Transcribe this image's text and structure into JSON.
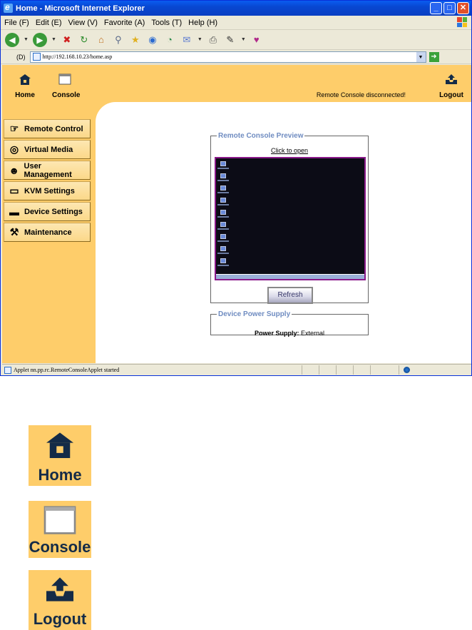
{
  "window": {
    "title": "Home - Microsoft Internet Explorer",
    "minimize": "_",
    "maximize": "□",
    "close": "✕"
  },
  "menu": [
    "File (F)",
    "Edit (E)",
    "View (V)",
    "Favorite (A)",
    "Tools (T)",
    "Help (H)"
  ],
  "address": {
    "label": "(D)",
    "url": "http://192.168.10.23/home.asp"
  },
  "header": {
    "home_label": "Home",
    "console_label": "Console",
    "logout_label": "Logout",
    "status_message": "Remote Console disconnected!"
  },
  "nav": {
    "items": [
      {
        "label": "Remote Control",
        "icon": "remote-control-icon"
      },
      {
        "label": "Virtual Media",
        "icon": "virtual-media-icon"
      },
      {
        "label": "User Management",
        "icon": "user-management-icon"
      },
      {
        "label": "KVM Settings",
        "icon": "kvm-settings-icon"
      },
      {
        "label": "Device Settings",
        "icon": "device-settings-icon"
      },
      {
        "label": "Maintenance",
        "icon": "maintenance-icon"
      }
    ]
  },
  "preview": {
    "legend": "Remote Console Preview",
    "click_label": "Click to open",
    "refresh_label": "Refresh"
  },
  "power": {
    "legend": "Device Power Supply",
    "label": "Power Supply:",
    "value": "External"
  },
  "statusbar": {
    "text": "Applet nn.pp.rc.RemoteConsoleApplet started"
  },
  "legend_icons": {
    "home": "Home",
    "console": "Console",
    "logout": "Logout"
  },
  "colors": {
    "page_bg": "#fecd6a",
    "nav_text": "#000000",
    "legend_text": "#6f8cc1",
    "icon_navy": "#142b47"
  }
}
